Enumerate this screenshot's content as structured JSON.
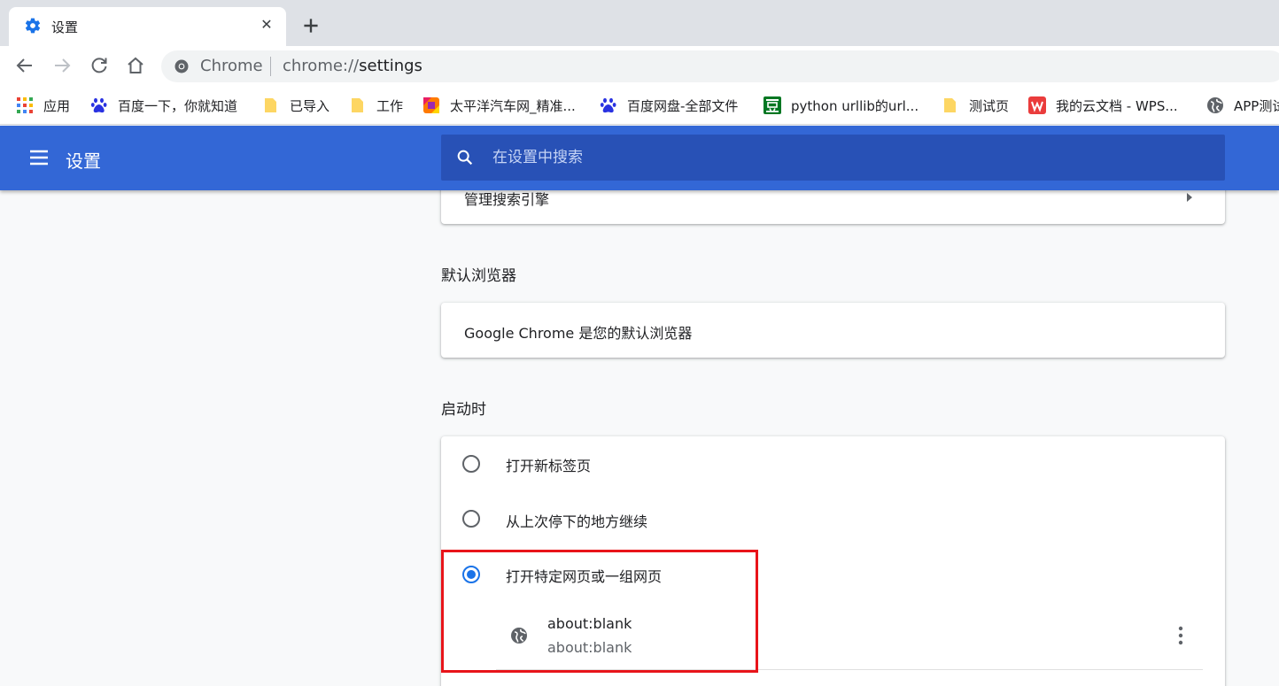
{
  "tab": {
    "title": "设置",
    "close": "✕"
  },
  "toolbar": {
    "omnibox_label": "Chrome",
    "url_scheme": "chrome://",
    "url_path": "settings"
  },
  "bookmarks": [
    {
      "label": "应用",
      "icon": "apps-grid-icon"
    },
    {
      "label": "百度一下，你就知道",
      "icon": "baidu-paw-icon"
    },
    {
      "label": "已导入",
      "icon": "folder-icon"
    },
    {
      "label": "工作",
      "icon": "folder-icon"
    },
    {
      "label": "太平洋汽车网_精准...",
      "icon": "pcauto-icon"
    },
    {
      "label": "百度网盘-全部文件",
      "icon": "baidu-paw-icon"
    },
    {
      "label": "python urllib的url...",
      "icon": "douban-icon"
    },
    {
      "label": "测试页",
      "icon": "folder-icon"
    },
    {
      "label": "我的云文档 - WPS...",
      "icon": "wps-icon"
    },
    {
      "label": "APP测试",
      "icon": "globe-icon"
    }
  ],
  "header": {
    "title": "设置",
    "search_placeholder": "在设置中搜索"
  },
  "search_engine": {
    "manage_label": "管理搜索引擎"
  },
  "default_browser": {
    "section_title": "默认浏览器",
    "status_text": "Google Chrome 是您的默认浏览器"
  },
  "startup": {
    "section_title": "启动时",
    "options": [
      {
        "label": "打开新标签页",
        "checked": false
      },
      {
        "label": "从上次停下的地方继续",
        "checked": false
      },
      {
        "label": "打开特定网页或一组网页",
        "checked": true
      }
    ],
    "pages": [
      {
        "title": "about:blank",
        "url": "about:blank"
      }
    ]
  },
  "colors": {
    "header_blue": "#3367d6",
    "search_blue": "#2851b6",
    "radio_checked": "#1a73e8",
    "highlight_red": "#e8141a"
  }
}
